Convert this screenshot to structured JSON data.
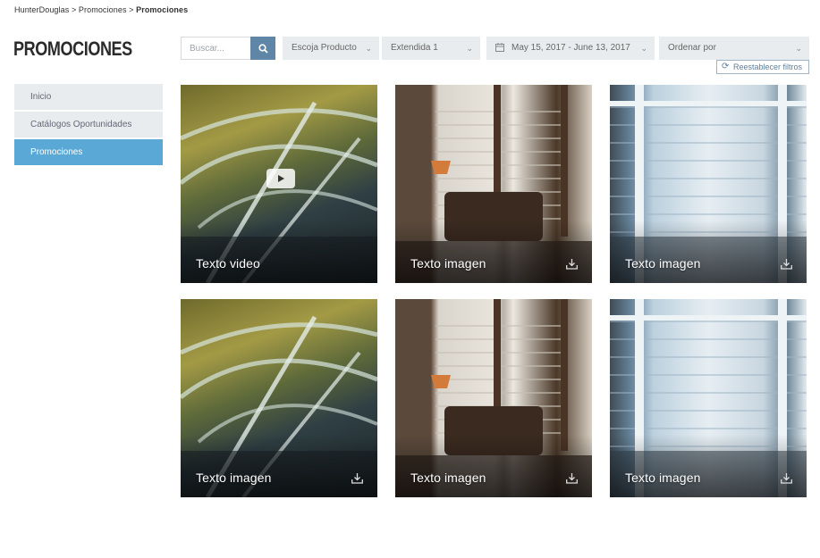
{
  "breadcrumb": {
    "items": [
      "HunterDouglas",
      "Promociones"
    ],
    "separator": ">",
    "current": "Promociones"
  },
  "page_title": "PROMOCIONES",
  "sidebar": {
    "items": [
      {
        "label": "Inicio",
        "active": false
      },
      {
        "label": "Catálogos Oportunidades",
        "active": false
      },
      {
        "label": "Promociones",
        "active": true
      }
    ]
  },
  "filters": {
    "search_placeholder": "Buscar...",
    "product_select": "Escoja Producto",
    "extension_select": "Extendida 1",
    "date_range": "May 15, 2017 - June 13, 2017",
    "sort_select": "Ordenar por",
    "reset_label": "Reestablecer filtros"
  },
  "cards": [
    {
      "caption": "Texto video",
      "type": "video",
      "image": "airport"
    },
    {
      "caption": "Texto imagen",
      "type": "image",
      "image": "living"
    },
    {
      "caption": "Texto imagen",
      "type": "image",
      "image": "blinds"
    },
    {
      "caption": "Texto imagen",
      "type": "image",
      "image": "airport"
    },
    {
      "caption": "Texto imagen",
      "type": "image",
      "image": "living"
    },
    {
      "caption": "Texto imagen",
      "type": "image",
      "image": "blinds"
    }
  ],
  "colors": {
    "accent": "#5aa8d6",
    "search_button": "#5f86a6",
    "filter_bg": "#e9ecee"
  }
}
